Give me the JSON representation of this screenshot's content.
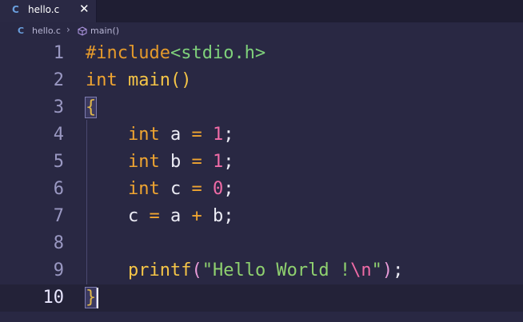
{
  "tab": {
    "icon": "c-language-icon",
    "icon_glyph": "C",
    "label": "hello.c",
    "close_glyph": "✕"
  },
  "breadcrumb": {
    "file_icon_glyph": "C",
    "file": "hello.c",
    "separator": "›",
    "symbol_icon": "method-cube-icon",
    "symbol": "main()"
  },
  "editor": {
    "current_line": 10,
    "lines": [
      {
        "n": "1"
      },
      {
        "n": "2"
      },
      {
        "n": "3"
      },
      {
        "n": "4"
      },
      {
        "n": "5"
      },
      {
        "n": "6"
      },
      {
        "n": "7"
      },
      {
        "n": "8"
      },
      {
        "n": "9"
      },
      {
        "n": "10"
      }
    ],
    "tokens": {
      "l1": [
        "#include",
        "<stdio.h>"
      ],
      "l2": [
        "int",
        " ",
        "main",
        "()"
      ],
      "l3": [
        "{"
      ],
      "l4": [
        "    ",
        "int",
        " a ",
        "=",
        " ",
        "1",
        ";"
      ],
      "l5": [
        "    ",
        "int",
        " b ",
        "=",
        " ",
        "1",
        ";"
      ],
      "l6": [
        "    ",
        "int",
        " c ",
        "=",
        " ",
        "0",
        ";"
      ],
      "l7": [
        "    c ",
        "=",
        " a ",
        "+",
        " b;"
      ],
      "l8": [
        ""
      ],
      "l9": [
        "    ",
        "printf",
        "(",
        "\"Hello World !",
        "\\n",
        "\"",
        ")",
        ";"
      ],
      "l10": [
        "}"
      ]
    }
  },
  "colors": {
    "background": "#292843",
    "keyword": "#f0a531",
    "string": "#8fd16f",
    "number": "#ef6ba6",
    "function": "#f5c547"
  }
}
